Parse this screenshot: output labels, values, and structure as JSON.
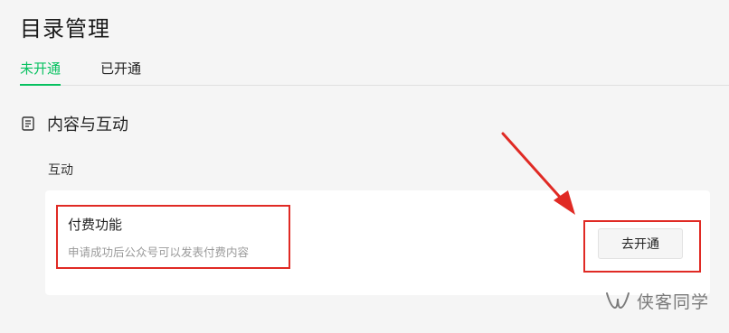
{
  "page": {
    "title": "目录管理"
  },
  "tabs": [
    {
      "label": "未开通",
      "active": true
    },
    {
      "label": "已开通",
      "active": false
    }
  ],
  "section": {
    "title": "内容与互动",
    "icon": "document-icon"
  },
  "group": {
    "label": "互动"
  },
  "feature": {
    "name": "付费功能",
    "description": "申请成功后公众号可以发表付费内容",
    "action_label": "去开通"
  },
  "annotations": {
    "highlight_color": "#e02a24",
    "accent_color": "#07c160"
  },
  "watermark": {
    "icon": "wechat-channel-icon",
    "text": "侠客同学"
  }
}
